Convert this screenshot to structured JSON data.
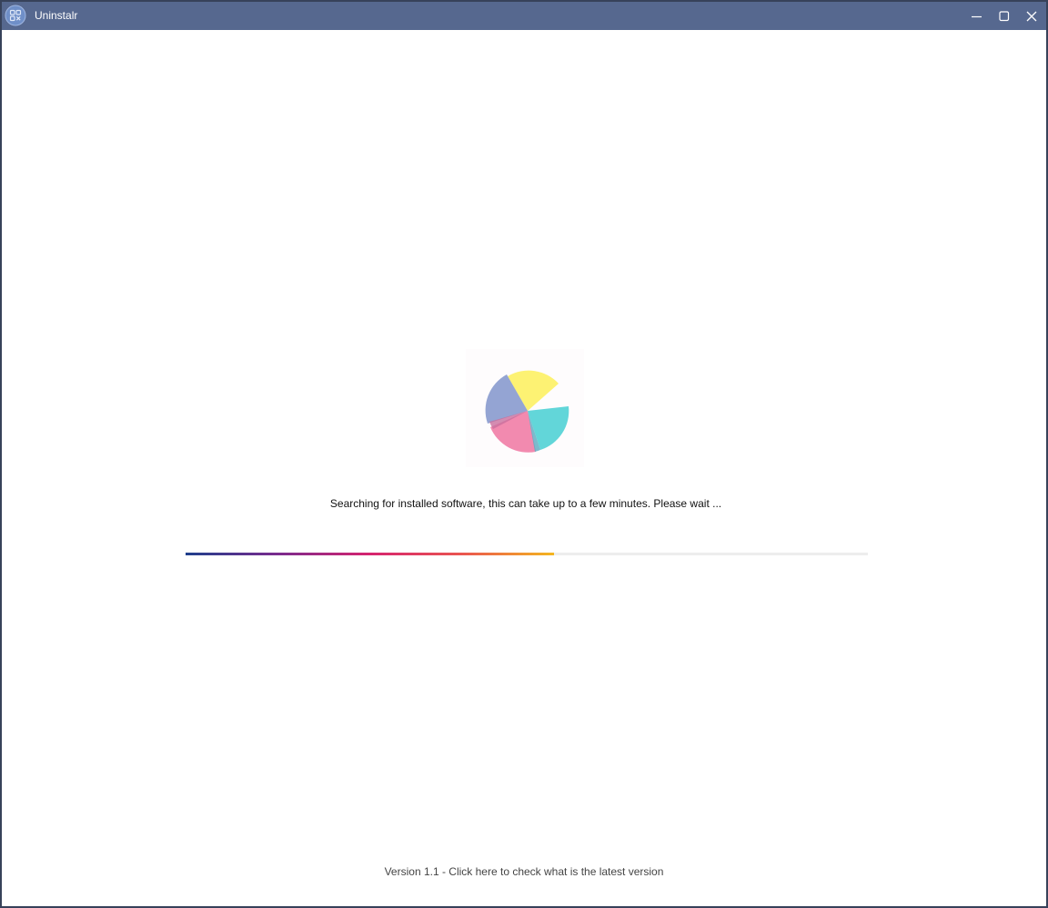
{
  "window": {
    "title": "Uninstalr",
    "colors": {
      "titlebar": "#56688f",
      "border": "#37425a"
    },
    "controls": {
      "minimize_icon": "minimize-icon",
      "maximize_icon": "maximize-icon",
      "close_icon": "close-icon"
    }
  },
  "main": {
    "spinner_icon": "pie-loading-icon",
    "spinner_colors": [
      "#fdf273",
      "#62d6d9",
      "#f28aaf",
      "#94a4d3"
    ],
    "status_text": "Searching for installed software, this can take up to a few minutes. Please wait ...",
    "progress": {
      "fraction": 0.54,
      "gradient_colors": [
        "#1e3f8c",
        "#7a2b8e",
        "#d6246f",
        "#ea5550",
        "#f4b61f"
      ],
      "track_color": "#ededed"
    }
  },
  "footer": {
    "version_link": "Version 1.1 - Click here to check what is the latest version"
  }
}
